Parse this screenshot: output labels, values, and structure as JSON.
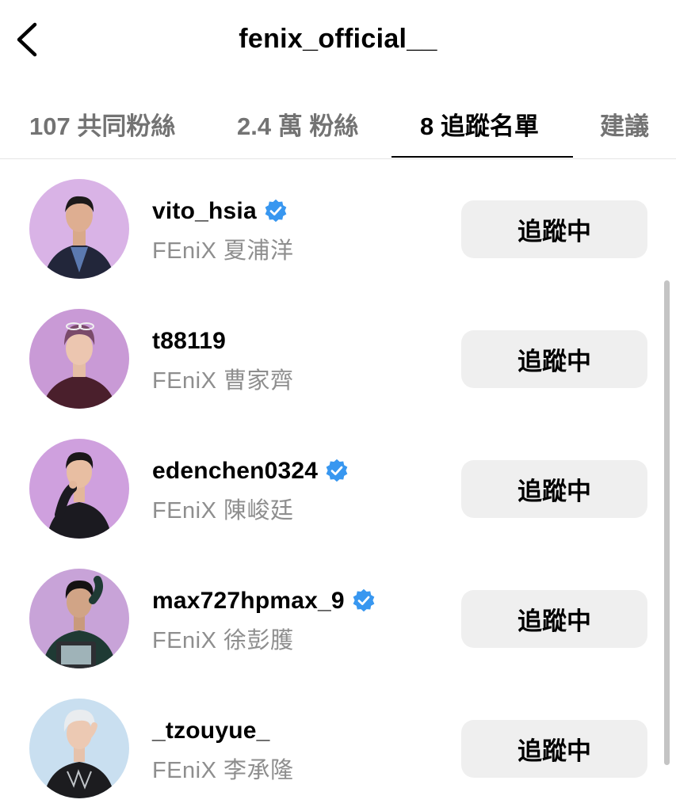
{
  "header": {
    "title": "fenix_official__",
    "back_icon": "chevron-left-icon"
  },
  "tabs": [
    {
      "label": "107 共同粉絲",
      "active": false
    },
    {
      "label": "2.4 萬 粉絲",
      "active": false
    },
    {
      "label": "8 追蹤名單",
      "active": true
    },
    {
      "label": "建議",
      "active": false
    }
  ],
  "list": [
    {
      "username": "vito_hsia",
      "verified": true,
      "fullname": "FEniX 夏浦洋",
      "button_label": "追蹤中",
      "avatar_bg": "#d9b3e6"
    },
    {
      "username": "t88119",
      "verified": false,
      "fullname": "FEniX 曹家齊",
      "button_label": "追蹤中",
      "avatar_bg": "#c99ad6"
    },
    {
      "username": "edenchen0324",
      "verified": true,
      "fullname": "FEniX 陳峻廷",
      "button_label": "追蹤中",
      "avatar_bg": "#cfa0de"
    },
    {
      "username": "max727hpmax_9",
      "verified": true,
      "fullname": "FEniX 徐彭臒",
      "button_label": "追蹤中",
      "avatar_bg": "#c8a3d8"
    },
    {
      "username": "_tzouyue_",
      "verified": false,
      "fullname": "FEniX 李承隆",
      "button_label": "追蹤中",
      "avatar_bg": "#c9dff0"
    }
  ],
  "colors": {
    "verified_badge": "#3897f0",
    "secondary_text": "#8e8e8e",
    "button_bg": "#efefef"
  }
}
